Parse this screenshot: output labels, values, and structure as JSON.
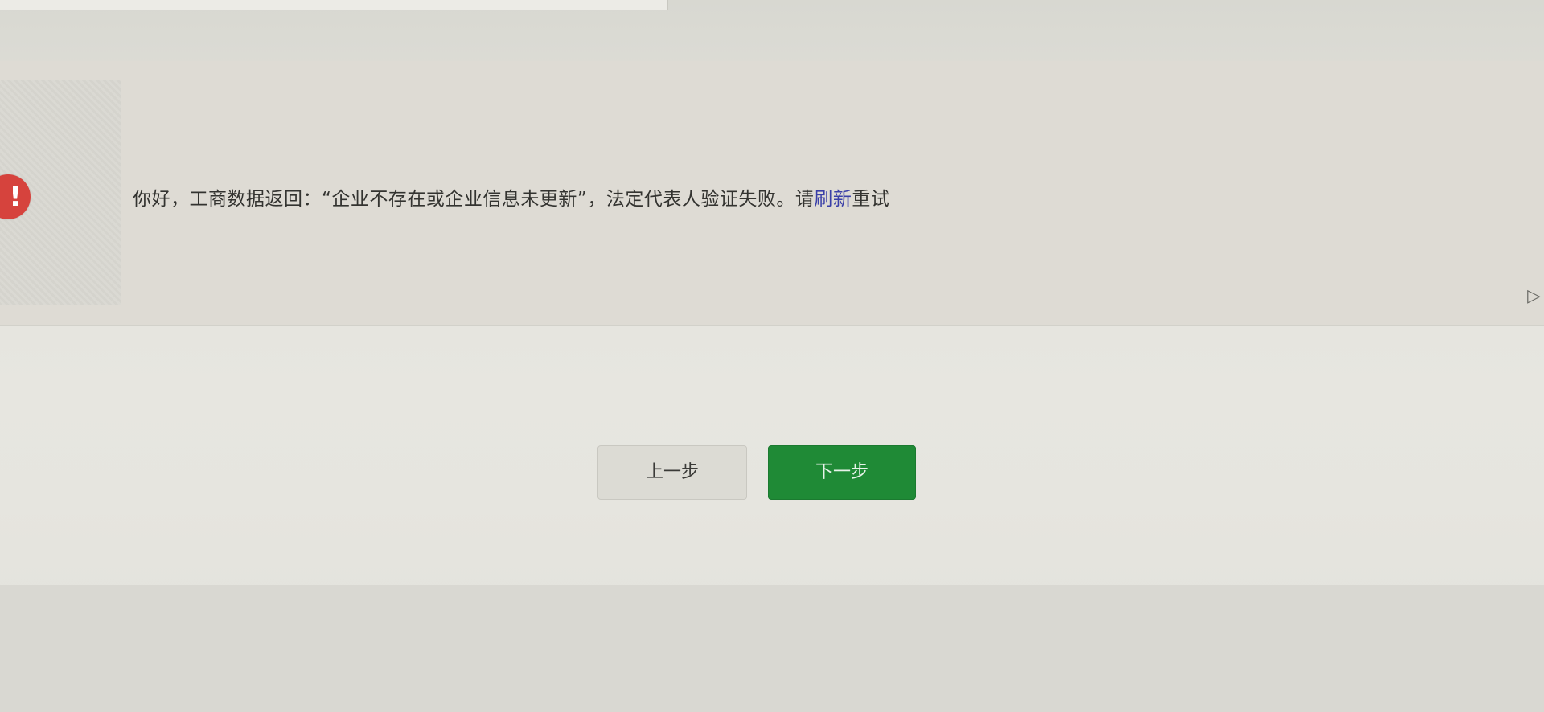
{
  "message": {
    "text": "你好，工商数据返回：“企业不存在或企业信息未更新”，法定代表人验证失败。请",
    "link_text": "刷新",
    "suffix": "重试"
  },
  "error_icon": {
    "glyph": "!",
    "icon": "exclamation-icon",
    "color": "#d6433d"
  },
  "buttons": {
    "prev_label": "上一步",
    "next_label": "下一步",
    "next_color": "#1f8a36"
  }
}
